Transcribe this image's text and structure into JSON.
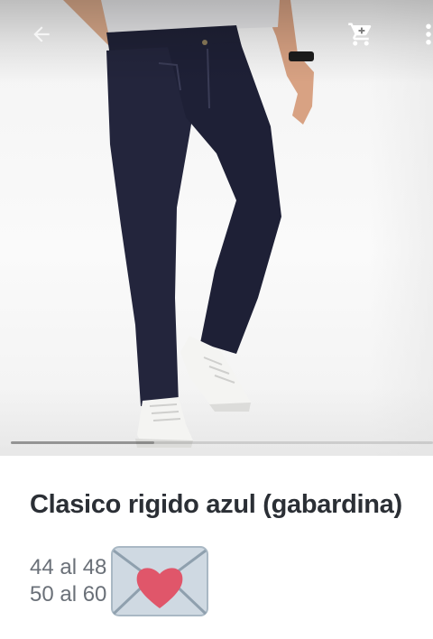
{
  "product": {
    "title": "Clasico rigido azul (gabardina)",
    "sizes": [
      "44 al 48",
      "50 al 60"
    ],
    "emoji": "envelope-with-heart"
  },
  "header": {
    "back_icon": "back-arrow-icon",
    "cart_icon": "shopping-cart-icon",
    "more_icon": "more-vert-icon"
  },
  "gallery": {
    "image_subject": "navy jeans with white sneakers",
    "progress": 0.34
  },
  "colors": {
    "title": "#2b2f35",
    "sizes_text": "#6a7078",
    "jeans": "#22243b",
    "heart": "#e0566a"
  }
}
